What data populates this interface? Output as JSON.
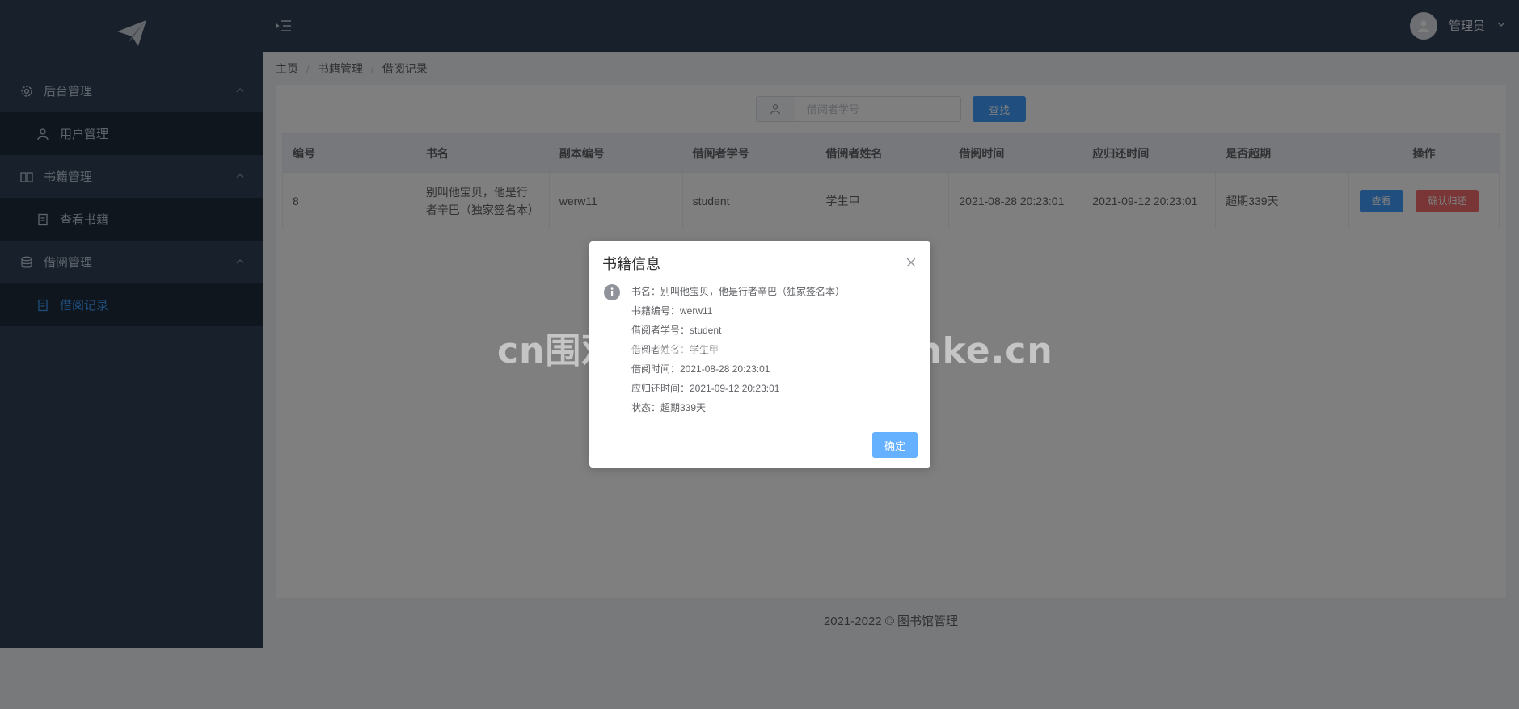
{
  "sidebar": {
    "logo_icon": "paper-plane-icon",
    "groups": [
      {
        "label": "后台管理",
        "icon": "gear-icon",
        "items": [
          {
            "label": "用户管理",
            "icon": "user-icon"
          }
        ]
      },
      {
        "label": "书籍管理",
        "icon": "book-icon",
        "items": [
          {
            "label": "查看书籍",
            "icon": "document-icon"
          }
        ]
      },
      {
        "label": "借阅管理",
        "icon": "database-icon",
        "items": [
          {
            "label": "借阅记录",
            "icon": "document-icon",
            "active": true
          }
        ]
      }
    ]
  },
  "navbar": {
    "user_name": "管理员"
  },
  "breadcrumb": [
    "主页",
    "书籍管理",
    "借阅记录"
  ],
  "search": {
    "placeholder": "借阅者学号",
    "button_label": "查找"
  },
  "table": {
    "headers": [
      "编号",
      "书名",
      "副本编号",
      "借阅者学号",
      "借阅者姓名",
      "借阅时间",
      "应归还时间",
      "是否超期",
      "操作"
    ],
    "rows": [
      {
        "id": "8",
        "title": "别叫他宝贝，他是行者辛巴（独家签名本）",
        "copy_id": "werw11",
        "student_id": "student",
        "student_name": "学生甲",
        "borrow_time": "2021-08-28 20:23:01",
        "due_time": "2021-09-12 20:23:01",
        "overdue": "超期339天",
        "view_label": "查看",
        "return_label": "确认归还"
      }
    ]
  },
  "footer": "2021-2022 © 图书馆管理",
  "dialog": {
    "title": "书籍信息",
    "lines": [
      "书名：别叫他宝贝，他是行者辛巴（独家签名本）",
      "书籍编号：werw11",
      "借阅者学号：student",
      "借阅者姓名：学生甲",
      "借阅时间：2021-08-28 20:23:01",
      "应归还时间：2021-09-12 20:23:01",
      "状态：超期339天"
    ],
    "ok_label": "确定"
  },
  "watermark": "cn围观客www.weiguanke.cn",
  "colors": {
    "sidebar_bg": "#304156",
    "primary": "#409eff",
    "danger": "#f56c6c",
    "active_menu": "#409eff"
  }
}
